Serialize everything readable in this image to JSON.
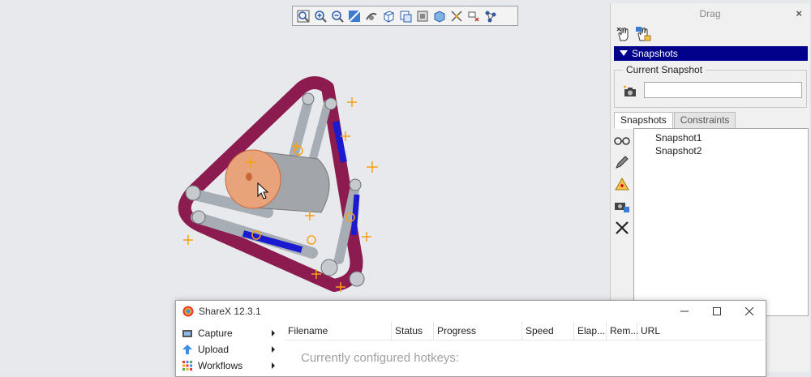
{
  "viewport": {
    "toolbar": {
      "tools": [
        "zoom-fit-icon",
        "zoom-in-icon",
        "zoom-out-icon",
        "zoom-area-icon",
        "rotate-view-icon",
        "view-cube-icon",
        "view-orient-icon",
        "render-mode-icon",
        "shading-icon",
        "snap-icon",
        "flyout-icon",
        "assembly-icon"
      ]
    }
  },
  "drag_panel": {
    "title": "Drag",
    "close": "×",
    "section_header": "Snapshots",
    "current_snapshot_label": "Current Snapshot",
    "current_snapshot_value": "",
    "tabs": [
      "Snapshots",
      "Constraints"
    ],
    "snapshots": [
      "Snapshot1",
      "Snapshot2"
    ]
  },
  "sharex": {
    "title": "ShareX 12.3.1",
    "menu": [
      {
        "label": "Capture",
        "icon": "capture-icon"
      },
      {
        "label": "Upload",
        "icon": "upload-icon"
      },
      {
        "label": "Workflows",
        "icon": "workflows-icon"
      }
    ],
    "columns": [
      "Filename",
      "Status",
      "Progress",
      "Speed",
      "Elap...",
      "Rem...",
      "URL"
    ],
    "hotkeys_text": "Currently configured hotkeys:"
  },
  "colors": {
    "frame": "#8c1b4f",
    "link": "#a7adb5",
    "blue_strut": "#1a1ad0",
    "orange": "#f7a01d",
    "header": "#00008b"
  }
}
